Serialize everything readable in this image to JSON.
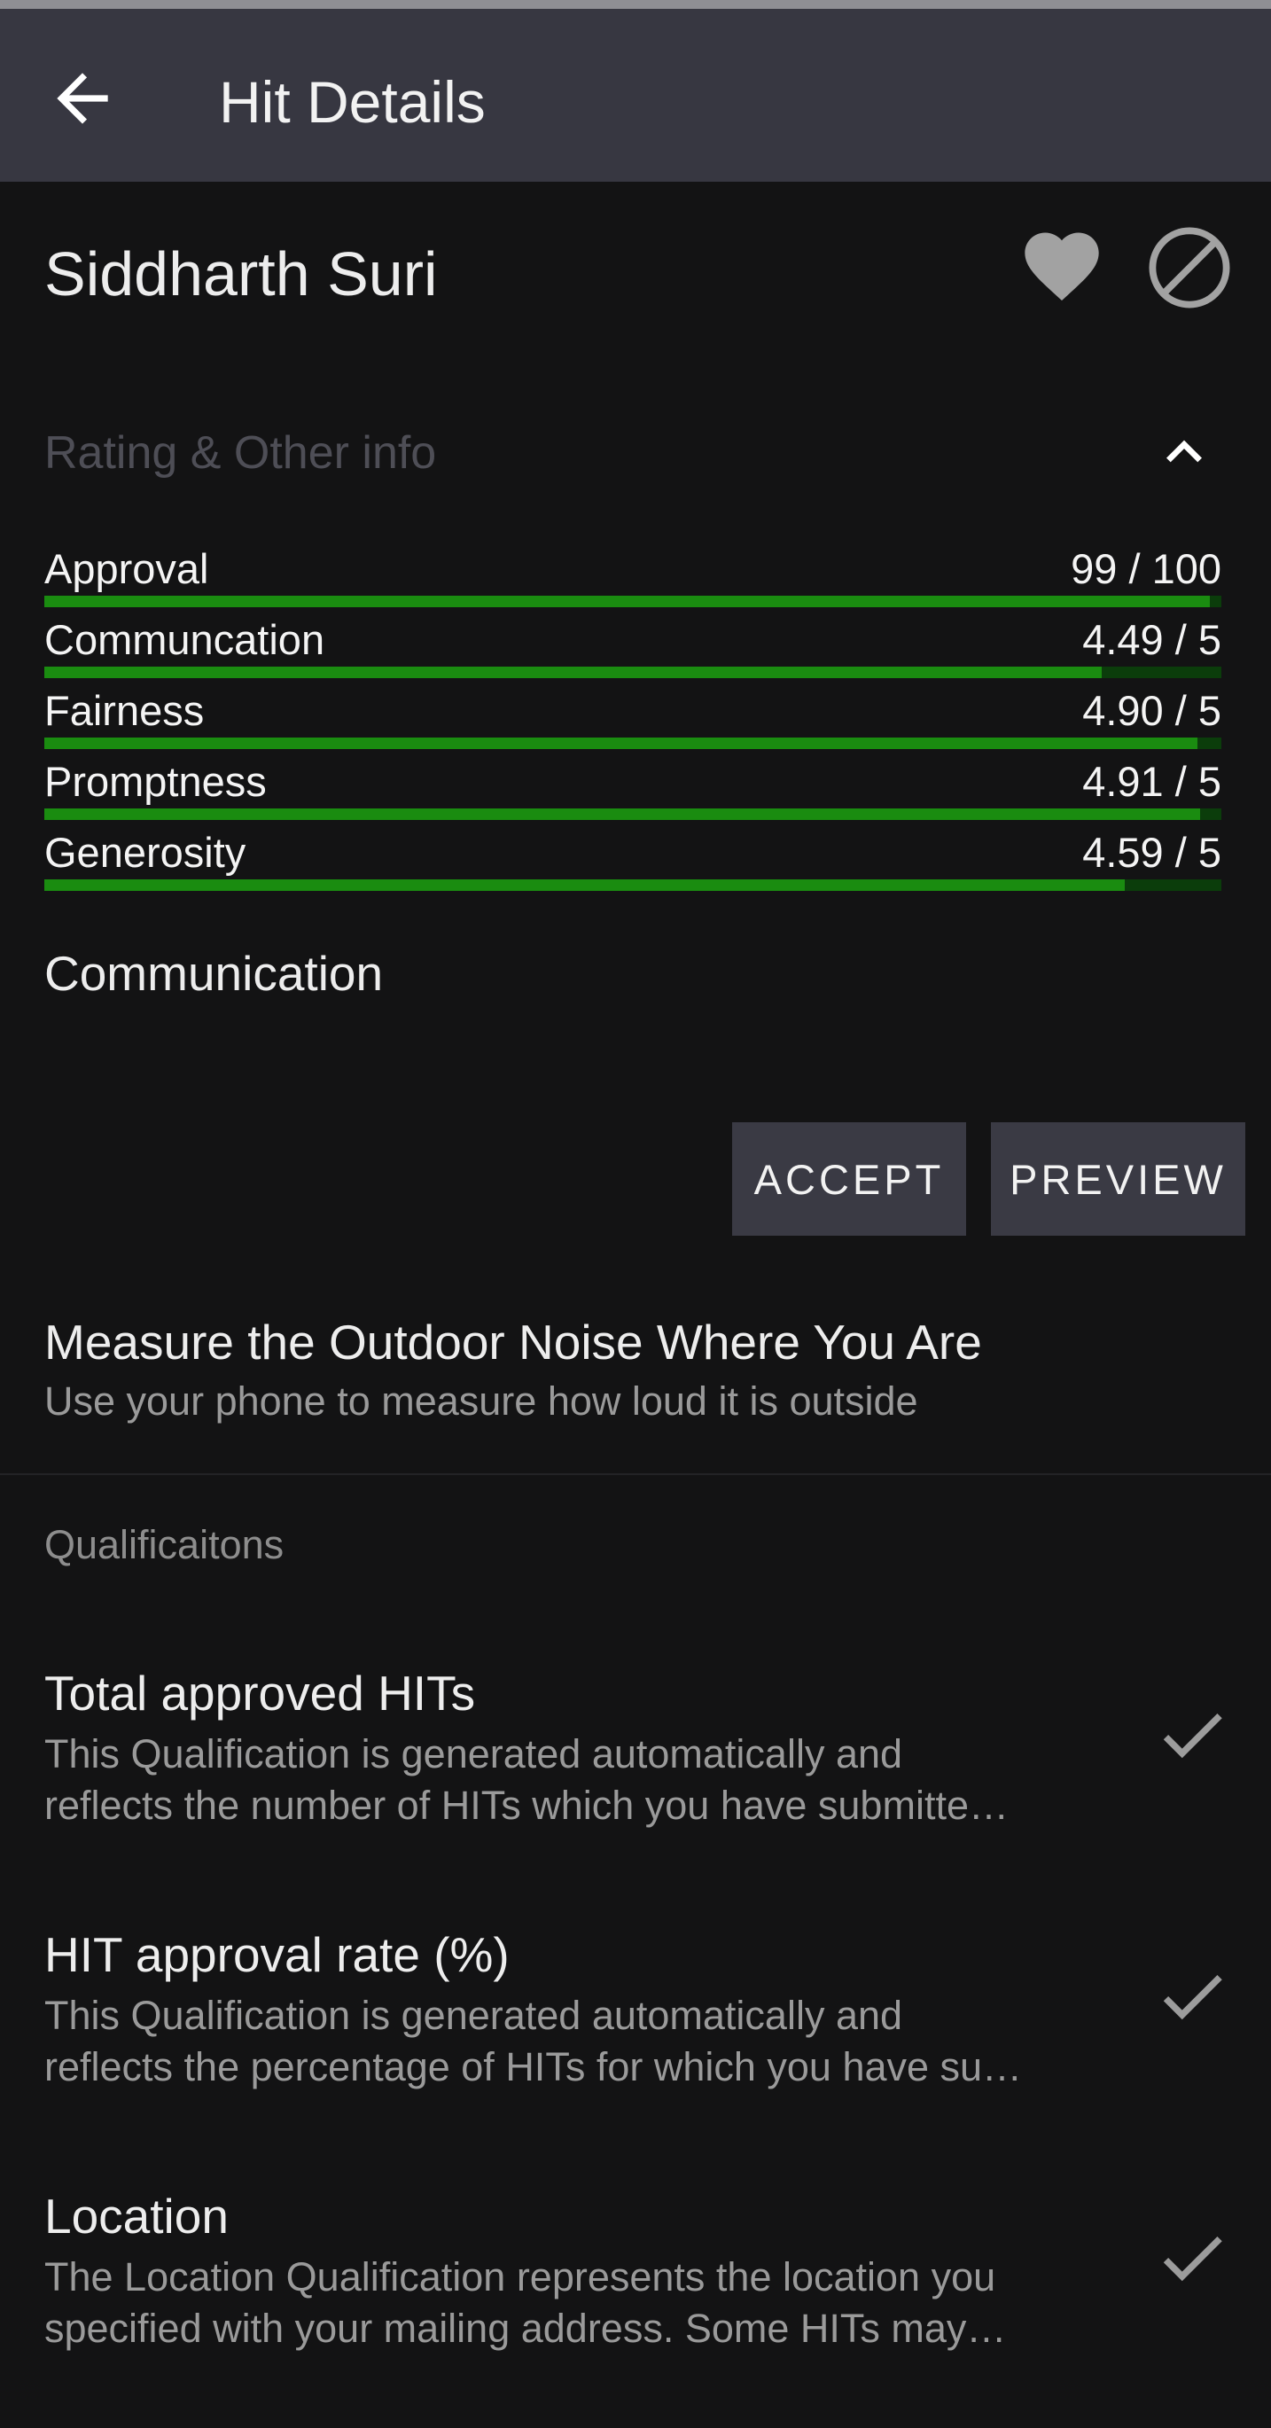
{
  "appbar": {
    "title": "Hit Details"
  },
  "requester": {
    "name": "Siddharth Suri"
  },
  "ratings": {
    "section_label": "Rating & Other info",
    "items": [
      {
        "label": "Approval",
        "value_text": "99 / 100",
        "fraction": 0.99
      },
      {
        "label": "Communcation",
        "value_text": "4.49 / 5",
        "fraction": 0.898
      },
      {
        "label": "Fairness",
        "value_text": "4.90 / 5",
        "fraction": 0.98
      },
      {
        "label": "Promptness",
        "value_text": "4.91 / 5",
        "fraction": 0.982
      },
      {
        "label": "Generosity",
        "value_text": "4.59 / 5",
        "fraction": 0.918
      }
    ],
    "selected_label": "Communication"
  },
  "actions": {
    "accept": "ACCEPT",
    "preview": "PREVIEW"
  },
  "hit": {
    "title": "Measure the Outdoor Noise Where You Are",
    "description": "Use your phone to measure how loud it is outside"
  },
  "qualifications": {
    "header": "Qualificaitons",
    "items": [
      {
        "title": "Total approved HITs",
        "line1": "This Qualification is generated automatically and",
        "line2": "reflects the number of HITs which you have submitte…"
      },
      {
        "title": "HIT approval rate (%)",
        "line1": "This Qualification is generated automatically and",
        "line2": "reflects the percentage of HITs for which you have su…"
      },
      {
        "title": "Location",
        "line1": "The Location Qualification represents the location you",
        "line2": "specified with your mailing address.  Some HITs may…"
      }
    ]
  },
  "colors": {
    "appbar": "#373741",
    "background": "#131314",
    "bar_fill": "#1a8c10",
    "bar_track": "#0b3d0b",
    "button": "#3a3a44"
  },
  "icons": {
    "back": "arrow-left-icon",
    "favorite": "heart-icon",
    "block": "block-icon",
    "collapse": "chevron-up-icon",
    "check": "check-icon"
  }
}
